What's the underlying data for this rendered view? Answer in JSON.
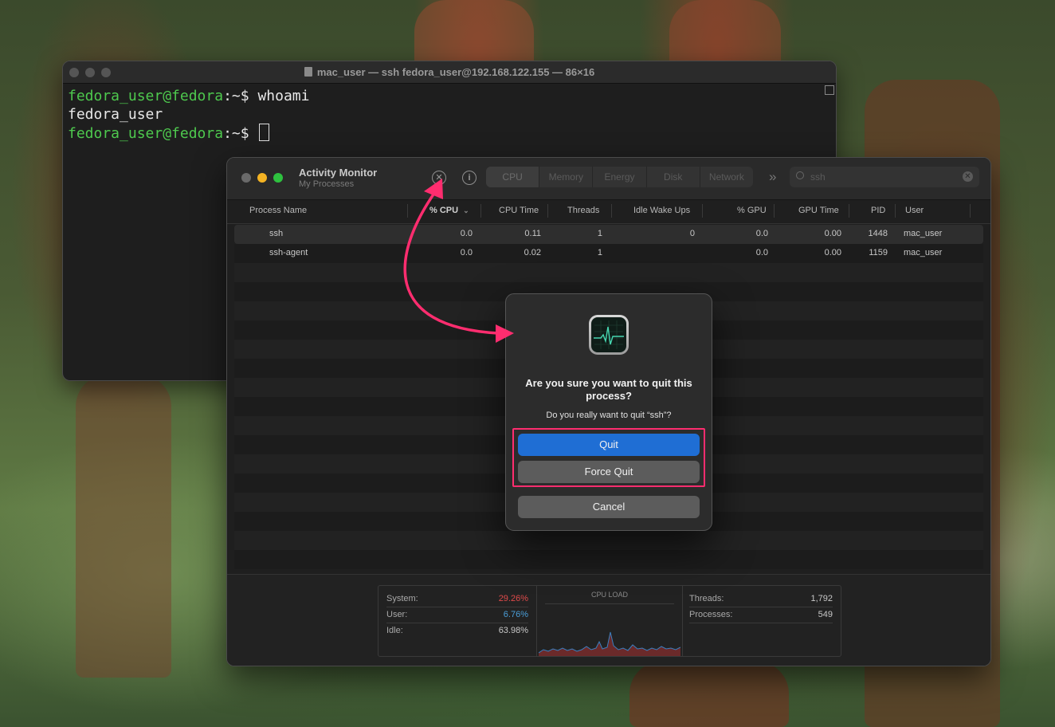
{
  "terminal": {
    "title": "mac_user — ssh fedora_user@192.168.122.155 — 86×16",
    "lines": [
      {
        "prompt_user": "fedora_user@fedora",
        "prompt_sep": ":~$ ",
        "command": "whoami"
      },
      {
        "output": "fedora_user"
      },
      {
        "prompt_user": "fedora_user@fedora",
        "prompt_sep": ":~$ "
      }
    ]
  },
  "activity_monitor": {
    "title": "Activity Monitor",
    "subtitle": "My Processes",
    "stop_icon": "x-circle-icon",
    "info_icon": "info-icon",
    "tabs": [
      "CPU",
      "Memory",
      "Energy",
      "Disk",
      "Network"
    ],
    "active_tab": "CPU",
    "search_value": "ssh",
    "columns": [
      "Process Name",
      "% CPU",
      "CPU Time",
      "Threads",
      "Idle Wake Ups",
      "% GPU",
      "GPU Time",
      "PID",
      "User"
    ],
    "rows": [
      {
        "name": "ssh",
        "cpu": "0.0",
        "cpu_time": "0.11",
        "threads": "1",
        "idle_wake": "0",
        "gpu": "0.0",
        "gpu_time": "0.00",
        "pid": "1448",
        "user": "mac_user"
      },
      {
        "name": "ssh-agent",
        "cpu": "0.0",
        "cpu_time": "0.02",
        "threads": "1",
        "idle_wake": "",
        "gpu": "0.0",
        "gpu_time": "0.00",
        "pid": "1159",
        "user": "mac_user"
      }
    ],
    "footer": {
      "system_label": "System:",
      "system_value": "29.26%",
      "user_label": "User:",
      "user_value": "6.76%",
      "idle_label": "Idle:",
      "idle_value": "63.98%",
      "cpu_load_title": "CPU LOAD",
      "threads_label": "Threads:",
      "threads_value": "1,792",
      "processes_label": "Processes:",
      "processes_value": "549",
      "colors": {
        "system": "#e04a4a",
        "user": "#4a9ed8"
      }
    }
  },
  "dialog": {
    "title": "Are you sure you want to quit this process?",
    "message": "Do you really want to quit “ssh”?",
    "quit_label": "Quit",
    "force_quit_label": "Force Quit",
    "cancel_label": "Cancel",
    "accent": "#1f6ed4"
  },
  "annotation": {
    "color": "#ff2d6f"
  }
}
